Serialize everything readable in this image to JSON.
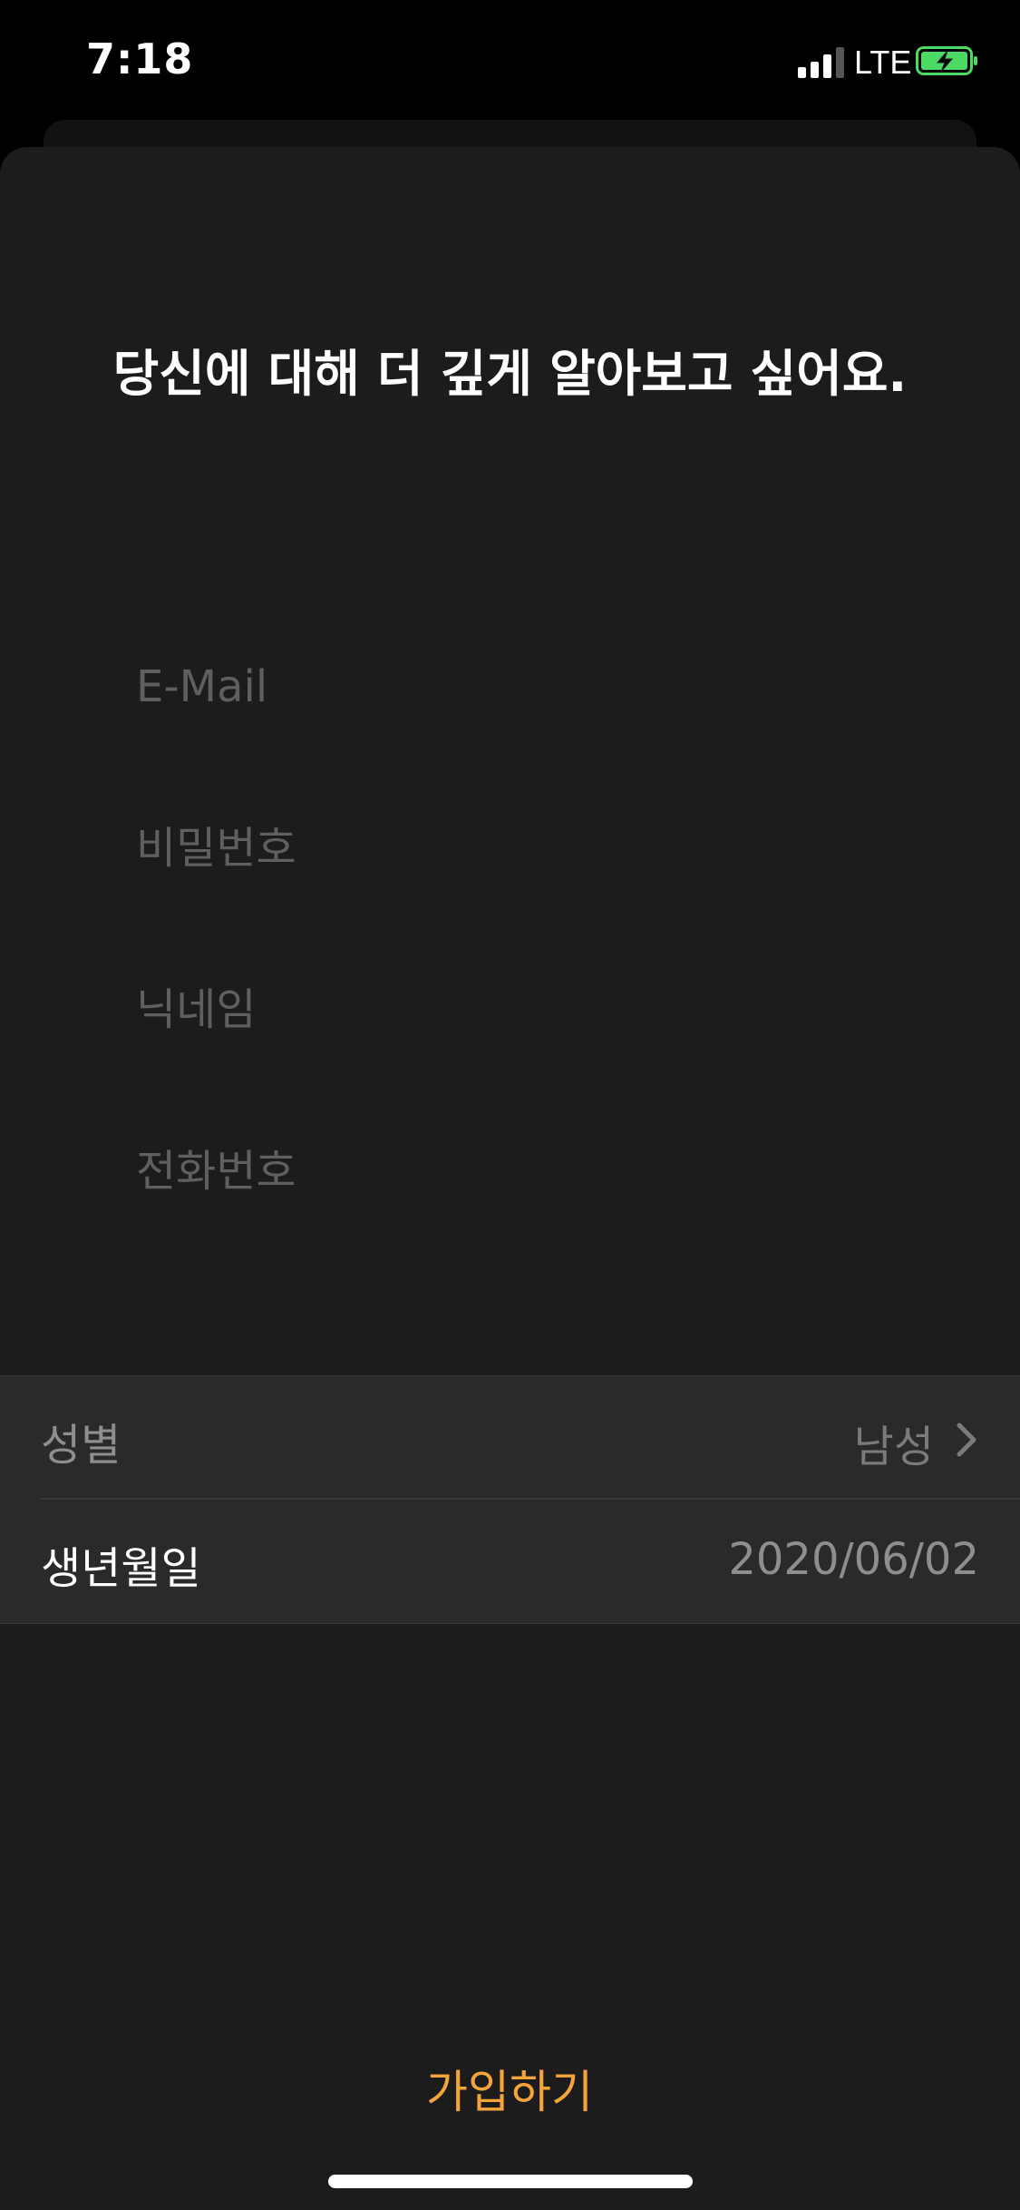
{
  "status_bar": {
    "time": "7:18",
    "network": "LTE",
    "signal_icon": "signal-bars-icon",
    "battery_icon": "battery-charging-icon",
    "battery_color": "#4cd964"
  },
  "signup": {
    "heading": "당신에 대해 더 깊게 알아보고 싶어요.",
    "fields": {
      "email_placeholder": "E-Mail",
      "email_value": "",
      "password_placeholder": "비밀번호",
      "password_value": "",
      "nickname_placeholder": "닉네임",
      "nickname_value": "",
      "phone_placeholder": "전화번호",
      "phone_value": ""
    },
    "gender": {
      "label": "성별",
      "value": "남성",
      "icon": "chevron-right-icon"
    },
    "birthdate": {
      "label": "생년월일",
      "value": "2020/06/02"
    },
    "submit_label": "가입하기",
    "accent_color": "#f5a43a"
  }
}
